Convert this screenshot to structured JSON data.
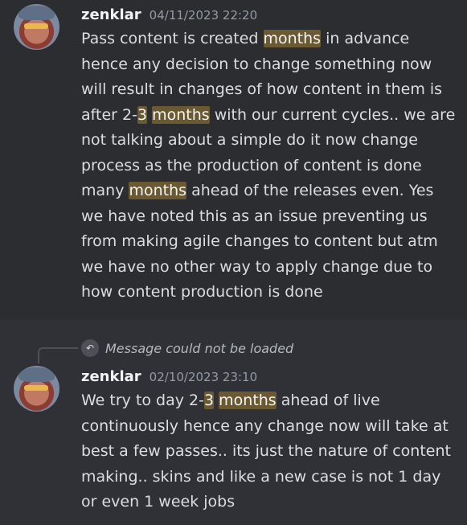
{
  "messages": [
    {
      "username": "zenklar",
      "timestamp": "04/11/2023 22:20",
      "segments": [
        {
          "text": "Pass content is created "
        },
        {
          "text": "months",
          "hl": true
        },
        {
          "text": " in advance hence any decision to change something now will result in changes of how content in them is after 2-"
        },
        {
          "text": "3",
          "hl": true
        },
        {
          "text": " "
        },
        {
          "text": "months",
          "hl": true
        },
        {
          "text": " with our current cycles.. we are not talking about a simple do it now change process as the production of content is done many "
        },
        {
          "text": "months",
          "hl": true
        },
        {
          "text": " ahead of the releases even. Yes we have noted this as an issue preventing us from making agile changes to content but atm we have no other way to apply change due to how content production is done"
        }
      ]
    },
    {
      "reply": {
        "text": "Message could not be loaded",
        "icon": "reply-arrow-icon"
      },
      "username": "zenklar",
      "timestamp": "02/10/2023 23:10",
      "segments": [
        {
          "text": "We try to day 2-"
        },
        {
          "text": "3",
          "hl": true
        },
        {
          "text": " "
        },
        {
          "text": "months",
          "hl": true
        },
        {
          "text": " ahead of live continuously hence any change now will take at best a few passes.. its just the nature of content making.. skins and like a new case is not 1 day or even 1 week jobs"
        }
      ]
    }
  ],
  "colors": {
    "highlight": "#6b5a31",
    "username": "#f2f3f5",
    "timestamp": "#949ba4",
    "text": "#dbdee1"
  }
}
